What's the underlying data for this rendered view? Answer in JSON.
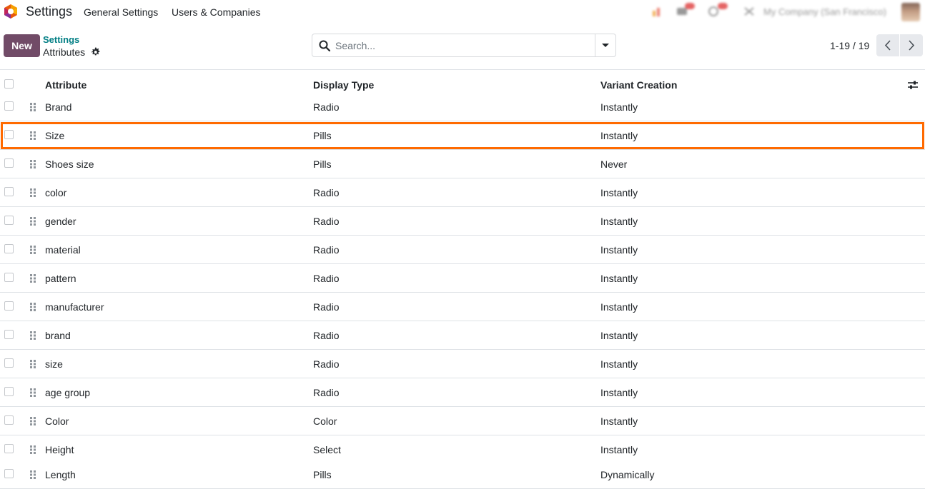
{
  "nav": {
    "app_title": "Settings",
    "menu": [
      "General Settings",
      "Users & Companies"
    ],
    "company": "My Company (San Francisco)"
  },
  "control": {
    "new_label": "New",
    "breadcrumb_parent": "Settings",
    "breadcrumb_current": "Attributes",
    "search_placeholder": "Search...",
    "pager": "1-19 / 19"
  },
  "list": {
    "columns": [
      "Attribute",
      "Display Type",
      "Variant Creation"
    ],
    "rows": [
      {
        "attribute": "Brand",
        "display_type": "Radio",
        "variant_creation": "Instantly"
      },
      {
        "attribute": "Size",
        "display_type": "Pills",
        "variant_creation": "Instantly"
      },
      {
        "attribute": "Shoes size",
        "display_type": "Pills",
        "variant_creation": "Never"
      },
      {
        "attribute": "color",
        "display_type": "Radio",
        "variant_creation": "Instantly"
      },
      {
        "attribute": "gender",
        "display_type": "Radio",
        "variant_creation": "Instantly"
      },
      {
        "attribute": "material",
        "display_type": "Radio",
        "variant_creation": "Instantly"
      },
      {
        "attribute": "pattern",
        "display_type": "Radio",
        "variant_creation": "Instantly"
      },
      {
        "attribute": "manufacturer",
        "display_type": "Radio",
        "variant_creation": "Instantly"
      },
      {
        "attribute": "brand",
        "display_type": "Radio",
        "variant_creation": "Instantly"
      },
      {
        "attribute": "size",
        "display_type": "Radio",
        "variant_creation": "Instantly"
      },
      {
        "attribute": "age group",
        "display_type": "Radio",
        "variant_creation": "Instantly"
      },
      {
        "attribute": "Color",
        "display_type": "Color",
        "variant_creation": "Instantly"
      },
      {
        "attribute": "Height",
        "display_type": "Select",
        "variant_creation": "Instantly"
      },
      {
        "attribute": "Length",
        "display_type": "Pills",
        "variant_creation": "Dynamically"
      }
    ]
  },
  "colors": {
    "primary": "#714b67",
    "breadcrumb": "#017e84",
    "highlight": "#ff6a00"
  },
  "icons": [
    "app-logo-icon",
    "gear-icon",
    "search-icon",
    "caret-down-icon",
    "chevron-left-icon",
    "chevron-right-icon",
    "column-settings-icon",
    "drag-handle-icon",
    "activity-icon",
    "chat-icon",
    "clock-icon",
    "tools-icon"
  ]
}
